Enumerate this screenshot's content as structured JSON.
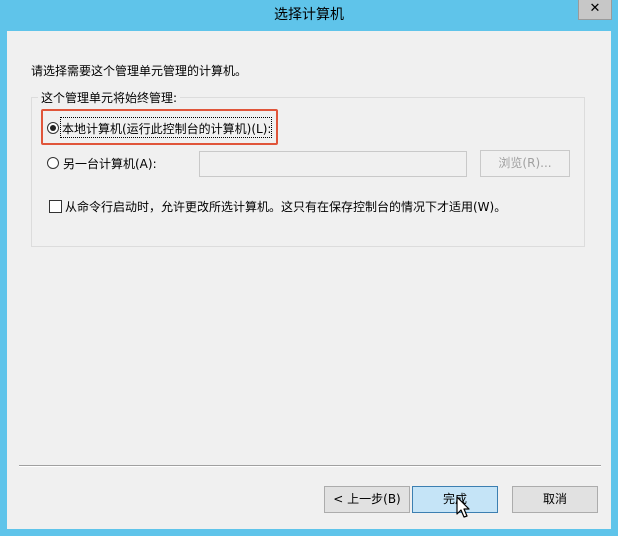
{
  "window": {
    "title": "选择计算机",
    "close_label": "✕"
  },
  "content": {
    "intro": "请选择需要这个管理单元管理的计算机。",
    "group_label": "这个管理单元将始终管理:",
    "options": {
      "local": {
        "label": "本地计算机(运行此控制台的计算机)(L):",
        "selected": true
      },
      "other": {
        "label": "另一台计算机(A):",
        "selected": false,
        "value": ""
      }
    },
    "browse_label": "浏览(R)...",
    "allow_change": {
      "label": "从命令行启动时，允许更改所选计算机。这只有在保存控制台的情况下才适用(W)。",
      "checked": false
    }
  },
  "footer": {
    "back_label": "< 上一步(B)",
    "finish_label": "完成",
    "cancel_label": "取消"
  },
  "colors": {
    "titlebar": "#5fc4ea",
    "highlight": "#e0553a",
    "default_button": "#c5e4f7"
  }
}
